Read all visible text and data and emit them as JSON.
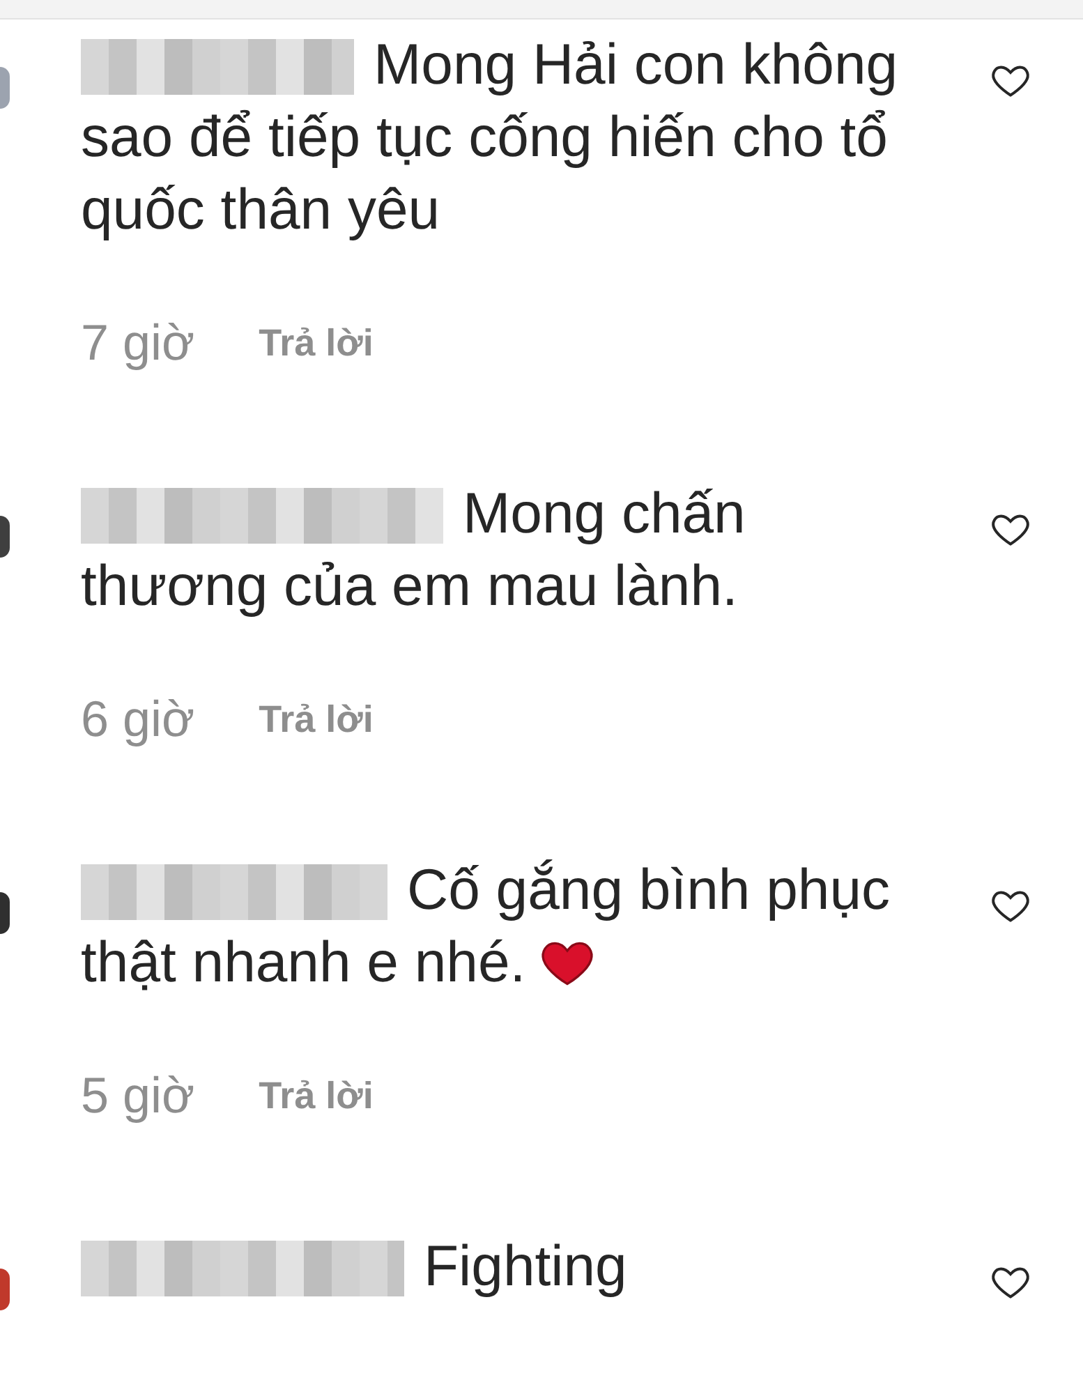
{
  "comments": [
    {
      "text": "Mong Hải con không sao để tiếp tục cống hiến cho tổ quốc thân yêu",
      "heart_emoji": false,
      "time": "7 giờ",
      "reply": "Trả lời",
      "liked": false
    },
    {
      "text": "Mong chấn thương của em mau lành.",
      "heart_emoji": false,
      "time": "6 giờ",
      "reply": "Trả lời",
      "liked": false
    },
    {
      "text": "Cố gắng bình phục thật nhanh e nhé.",
      "heart_emoji": true,
      "time": "5 giờ",
      "reply": "Trả lời",
      "liked": false
    },
    {
      "text": "Fighting",
      "heart_emoji": false,
      "liked": false
    }
  ]
}
